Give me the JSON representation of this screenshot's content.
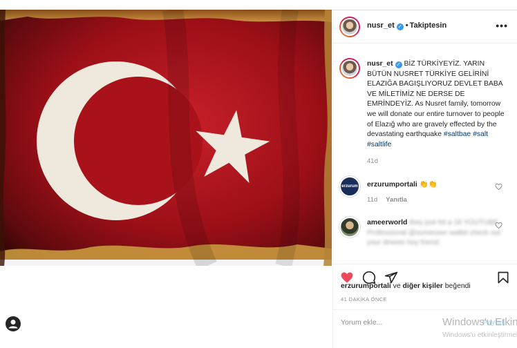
{
  "header": {
    "username": "nusr_et",
    "dot": "•",
    "follow_status": "Takiptesin",
    "more_icon": "more-horizontal-icon"
  },
  "caption": {
    "username": "nusr_et",
    "text": "BİZ TÜRKİYEYİZ. YARIN BÜTÜN NUSRET TÜRKİYE GELİRİNİ ELAZIĞA BAGIŞLIYORUZ DEVLET BABA VE MİLETİMİZ NE DERSE DE EMRİNDEYİZ. As Nusret family, tomorrow we will donate our entire turnover to people of Elazığ who are gravely effected by the devastating earthquake",
    "tags": [
      "#saltbae",
      "#salt",
      "#saltlife"
    ],
    "time": "41d"
  },
  "comments": [
    {
      "username": "erzurumportali",
      "text": "👏👏",
      "time": "11d",
      "reply_label": "Yanıtla",
      "avatar_text": "erzurum"
    },
    {
      "username": "ameerworld",
      "text": "they just hit a 18 YOUTUBE Professional @someuser wallet check out your dmeee hey friend."
    }
  ],
  "actions": {
    "like_icon": "heart-filled-icon",
    "comment_icon": "comment-bubble-icon",
    "share_icon": "send-paper-plane-icon",
    "save_icon": "bookmark-icon",
    "like_color": "#ed4956"
  },
  "likes": {
    "user": "erzurumportali",
    "connector": "ve",
    "others": "diğer kişiler",
    "suffix": "beğendi"
  },
  "post_time": "41 DAKİKA ÖNCE",
  "comment_box": {
    "placeholder": "Yorum ekle...",
    "post_label": "Paylaş"
  },
  "watermark": {
    "title": "Windows'u Etkinleştir",
    "subtitle": "Windows'u etkinleştirmek için Ayarlar'a gidin."
  },
  "colors": {
    "flag_red": "#b0141b",
    "flag_white": "#f3efe9",
    "link_blue": "#00376b",
    "verified_blue": "#3897f0"
  }
}
